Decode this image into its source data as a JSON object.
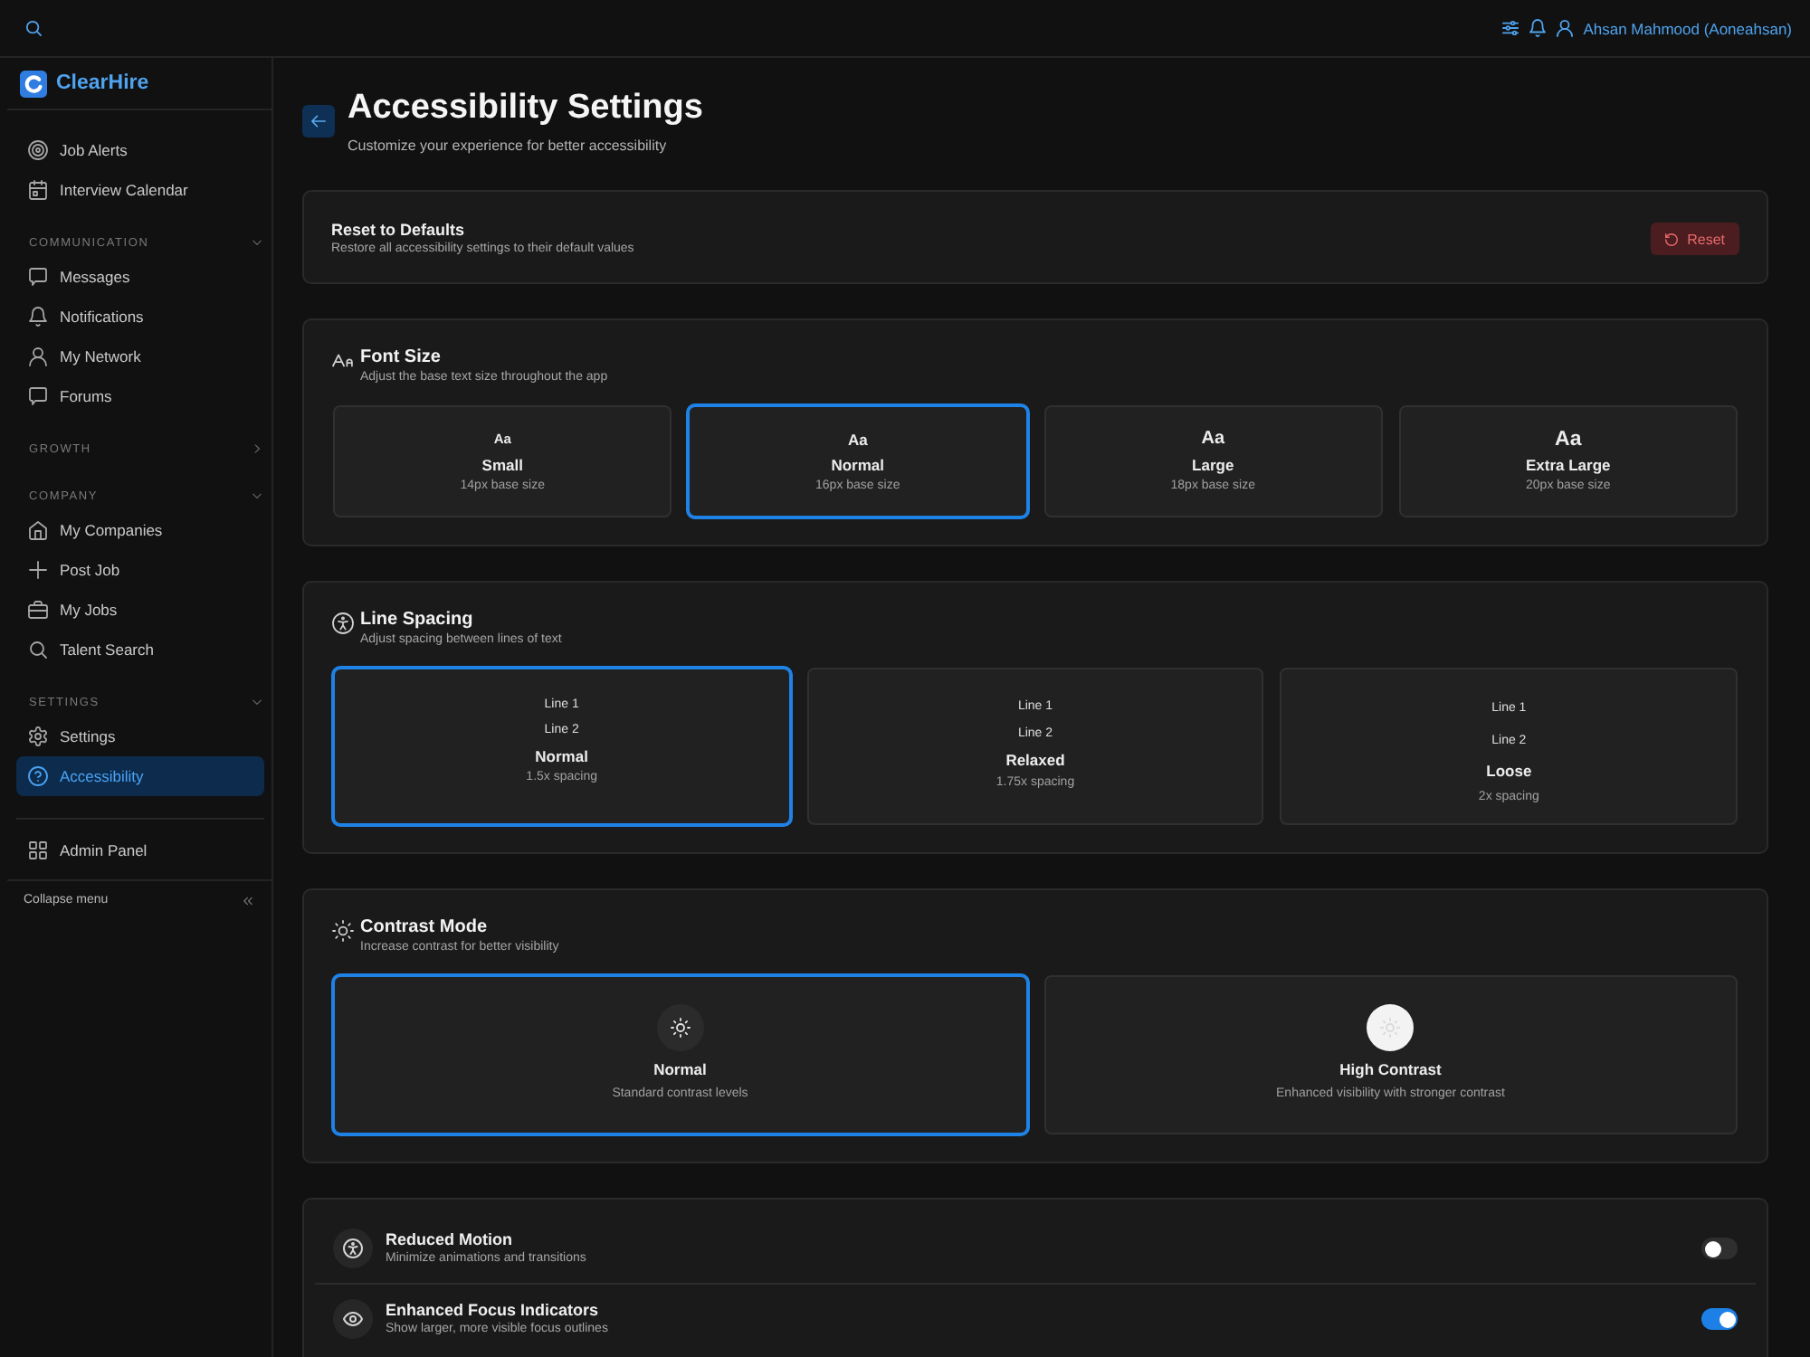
{
  "top_bar": {
    "user_name": "Ahsan Mahmood (Aoneahsan)"
  },
  "sidebar": {
    "brand": "ClearHire",
    "groups": [
      {
        "items": [
          {
            "label": "Job Alerts",
            "selected": false
          },
          {
            "label": "Interview Calendar",
            "selected": false
          }
        ]
      },
      {
        "title": "COMMUNICATION",
        "expanded": true,
        "items": [
          {
            "label": "Messages",
            "selected": false
          },
          {
            "label": "Notifications",
            "selected": false
          },
          {
            "label": "My Network",
            "selected": false
          },
          {
            "label": "Forums",
            "selected": false
          }
        ]
      },
      {
        "title": "GROWTH",
        "expanded": false
      },
      {
        "title": "COMPANY",
        "expanded": true,
        "items": [
          {
            "label": "My Companies",
            "selected": false
          },
          {
            "label": "Post Job",
            "selected": false
          },
          {
            "label": "My Jobs",
            "selected": false
          },
          {
            "label": "Talent Search",
            "selected": false
          }
        ]
      },
      {
        "title": "SETTINGS",
        "expanded": true,
        "items": [
          {
            "label": "Settings",
            "selected": false
          },
          {
            "label": "Accessibility",
            "selected": true
          }
        ]
      }
    ],
    "footer_items": [
      {
        "label": "Admin Panel",
        "selected": false
      }
    ],
    "collapse_label": "Collapse menu"
  },
  "page": {
    "title": "Accessibility Settings",
    "subtitle": "Customize your experience for better accessibility"
  },
  "reset_card": {
    "title": "Reset to Defaults",
    "description": "Restore all accessibility settings to their default values",
    "button": "Reset"
  },
  "font_size": {
    "title": "Font Size",
    "description": "Adjust the base text size throughout the app",
    "options": [
      {
        "sample": "Aa",
        "label": "Small",
        "detail": "14px base size",
        "selected": false
      },
      {
        "sample": "Aa",
        "label": "Normal",
        "detail": "16px base size",
        "selected": true
      },
      {
        "sample": "Aa",
        "label": "Large",
        "detail": "18px base size",
        "selected": false
      },
      {
        "sample": "Aa",
        "label": "Extra Large",
        "detail": "20px base size",
        "selected": false
      }
    ]
  },
  "line_spacing": {
    "title": "Line Spacing",
    "description": "Adjust spacing between lines of text",
    "options": [
      {
        "lines": [
          "Line 1",
          "Line 2"
        ],
        "label": "Normal",
        "detail": "1.5x spacing",
        "selected": true
      },
      {
        "lines": [
          "Line 1",
          "Line 2"
        ],
        "label": "Relaxed",
        "detail": "1.75x spacing",
        "selected": false
      },
      {
        "lines": [
          "Line 1",
          "Line 2"
        ],
        "label": "Loose",
        "detail": "2x spacing",
        "selected": false
      }
    ]
  },
  "contrast_mode": {
    "title": "Contrast Mode",
    "description": "Increase contrast for better visibility",
    "options": [
      {
        "kind": "standard",
        "label": "Normal",
        "detail": "Standard contrast levels",
        "selected": true
      },
      {
        "kind": "high",
        "label": "High Contrast",
        "detail": "Enhanced visibility with stronger contrast",
        "selected": false
      }
    ]
  },
  "toggles": [
    {
      "title": "Reduced Motion",
      "description": "Minimize animations and transitions",
      "on": false
    },
    {
      "title": "Enhanced Focus Indicators",
      "description": "Show larger, more visible focus outlines",
      "on": true
    }
  ]
}
